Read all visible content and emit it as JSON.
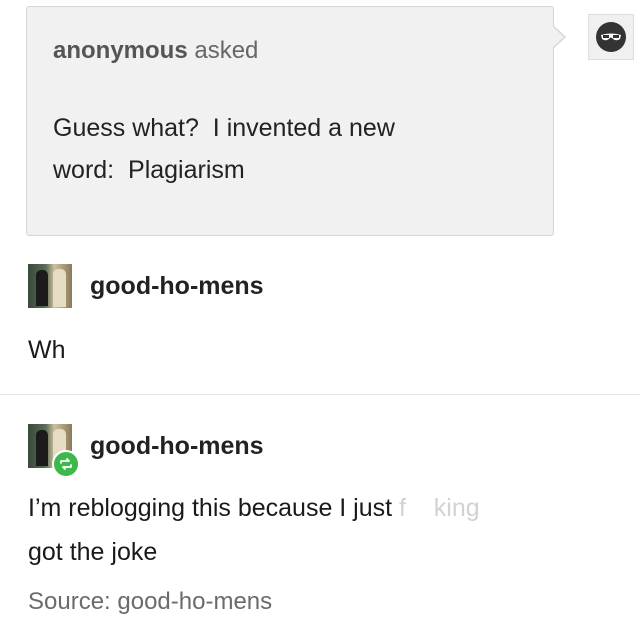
{
  "ask": {
    "asker": "anonymous",
    "asked_label": "asked",
    "question_line1": "Guess what?  I invented a new",
    "question_line2": "word:  Plagiarism",
    "avatar_icon": "anonymous-sunglasses-icon"
  },
  "posts": [
    {
      "username": "good-ho-mens",
      "text": "Wh",
      "avatar_icon": "user-avatar"
    },
    {
      "username": "good-ho-mens",
      "text_main": "I’m reblogging this because I just",
      "text_faded": "f    king",
      "text_line2": "got the joke",
      "avatar_icon": "user-avatar",
      "badge_icon": "reblog-icon"
    }
  ],
  "source": {
    "label": "Source: good-ho-mens"
  },
  "colors": {
    "ask_bg": "#f1f1f1",
    "reblog_badge": "#3cb84c",
    "text": "#1a1a1a",
    "muted": "#6b6b6b"
  }
}
